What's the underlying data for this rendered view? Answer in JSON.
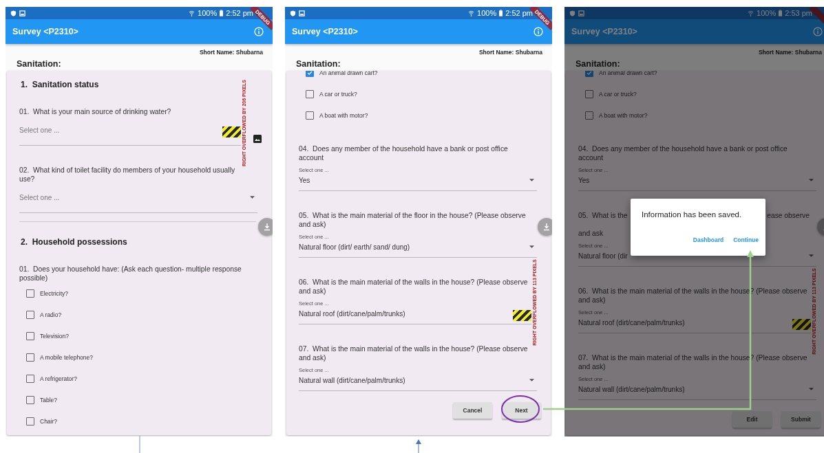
{
  "screens": [
    {
      "status_bar": {
        "battery": "100%",
        "time": "2:52 pm"
      },
      "debug_label": "DEBUG",
      "app_bar": {
        "title": "Survey <P2310>"
      },
      "short_name": "Short Name: Shubarna",
      "page_title": "Sanitation:",
      "dimmed": false,
      "scrolled": false,
      "blocks": [
        {
          "kind": "section",
          "text": "1.  Sanitation status"
        },
        {
          "kind": "question",
          "text": "01.  What is your main source of drinking water?"
        },
        {
          "kind": "select",
          "placeholder": "Select one ...",
          "dropdown": false,
          "overflow": "RIGHT OVERFLOWED BY 206 PIXELS",
          "image_icon": true
        },
        {
          "kind": "question",
          "text": "02.  What kind of toilet facility do members of your household usually use?"
        },
        {
          "kind": "select",
          "placeholder": "Select one ...",
          "dropdown": true
        },
        {
          "kind": "divider"
        },
        {
          "kind": "section",
          "text": "2.  Household possessions"
        },
        {
          "kind": "question",
          "text": "01.  Does your household have: (Ask each question- multiple response possible)"
        },
        {
          "kind": "checkbox",
          "label": "Electricity?",
          "checked": false
        },
        {
          "kind": "checkbox",
          "label": "A radio?",
          "checked": false
        },
        {
          "kind": "checkbox",
          "label": "Television?",
          "checked": false
        },
        {
          "kind": "checkbox",
          "label": "A mobile telephone?",
          "checked": false
        },
        {
          "kind": "checkbox",
          "label": "A refrigerator?",
          "checked": false
        },
        {
          "kind": "checkbox",
          "label": "Table?",
          "checked": false
        },
        {
          "kind": "checkbox",
          "label": "Chair?",
          "checked": false
        }
      ]
    },
    {
      "status_bar": {
        "battery": "100%",
        "time": "2:52 pm"
      },
      "debug_label": "DEBUG",
      "app_bar": {
        "title": "Survey <P2310>"
      },
      "short_name": "Short Name: Shubarna",
      "page_title": "Sanitation:",
      "dimmed": false,
      "scrolled": true,
      "blocks": [
        {
          "kind": "checkbox",
          "label": "An animal drawn cart?",
          "checked": true
        },
        {
          "kind": "checkbox",
          "label": "A car or truck?",
          "checked": false
        },
        {
          "kind": "checkbox",
          "label": "A boat with motor?",
          "checked": false
        },
        {
          "kind": "question",
          "text": "04.  Does any member of the household have a bank or post office account"
        },
        {
          "kind": "select",
          "label": "Select one ...",
          "value": "Yes",
          "dropdown": true
        },
        {
          "kind": "question",
          "text": "05.  What is the main material of the floor in the house? (Please observe and ask)"
        },
        {
          "kind": "select",
          "label": "Select one ...",
          "value": "Natural floor (dirt/ earth/ sand/ dung)",
          "dropdown": true
        },
        {
          "kind": "question",
          "text": "06.  What is the main material of the walls in the house? (Please observe and ask)"
        },
        {
          "kind": "select",
          "label": "Select one ...",
          "value": "Natural roof (dirt/cane/palm/trunks)",
          "dropdown": false,
          "overflow": "RIGHT OVERFLOWED BY 113 PIXELS"
        },
        {
          "kind": "question",
          "text": "07.  What is the main material of the walls in the house? (Please observe and ask)"
        },
        {
          "kind": "select",
          "label": "Select one ...",
          "value": "Natural wall (dirt/cane/palm/trunks)",
          "dropdown": true
        }
      ],
      "buttons": [
        "Cancel",
        "Next"
      ]
    },
    {
      "status_bar": {
        "battery": "100%",
        "time": "2:53 pm"
      },
      "app_bar": {
        "title": "Survey <P2310>"
      },
      "short_name": "Short Name: Shubarna",
      "page_title": "Sanitation:",
      "dimmed": true,
      "scrolled": true,
      "blocks": [
        {
          "kind": "checkbox",
          "label": "An animal drawn cart?",
          "checked": true
        },
        {
          "kind": "checkbox",
          "label": "A car or truck?",
          "checked": false
        },
        {
          "kind": "checkbox",
          "label": "A boat with motor?",
          "checked": false
        },
        {
          "kind": "question",
          "text": "04.  Does any member of the household have a bank or post office account"
        },
        {
          "kind": "select",
          "label": "Select one ...",
          "value": "Yes",
          "dropdown": true
        },
        {
          "kind": "question",
          "text": "05.  What is the",
          "text_right": "ease observe",
          "text_line2": "and ask"
        },
        {
          "kind": "select",
          "label": "Select one ...",
          "value": "Natural floor (dir",
          "dropdown": true
        },
        {
          "kind": "question",
          "text": "06.  What is the main material of the walls in the house? (Please observe and ask)"
        },
        {
          "kind": "select",
          "label": "Select one ...",
          "value": "Natural roof (dirt/cane/palm/trunks)",
          "dropdown": false,
          "overflow": "RIGHT OVERFLOWED BY 113 PIXELS"
        },
        {
          "kind": "question",
          "text": "07.  What is the main material of the walls in the house? (Please observe and ask)"
        },
        {
          "kind": "select",
          "label": "Select one ...",
          "value": "Natural wall (dirt/cane/palm/trunks)",
          "dropdown": true
        }
      ],
      "buttons": [
        "Edit",
        "Submit"
      ],
      "dialog": {
        "message": "Information has been saved.",
        "actions": [
          "Dashboard",
          "Continue"
        ]
      }
    }
  ]
}
